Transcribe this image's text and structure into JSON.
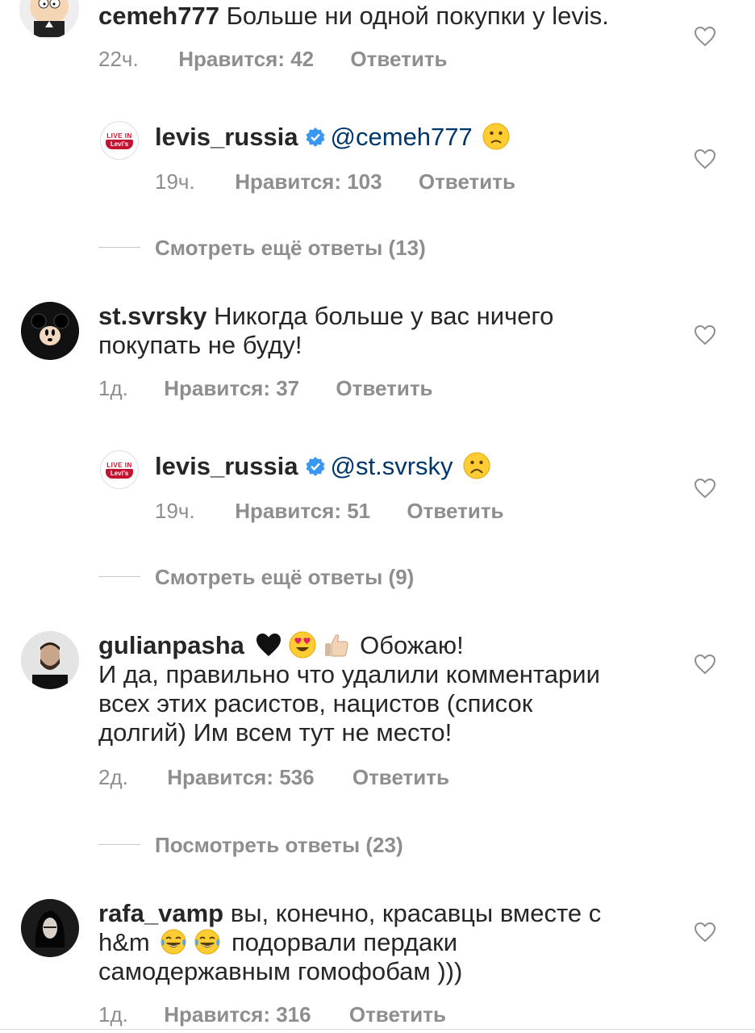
{
  "comments": [
    {
      "user": "cemeh777",
      "text": "Больше ни одной покупки у levis.",
      "time": "22ч.",
      "likes": "Нравится: 42",
      "reply": "Ответить",
      "avatar": "south-park-avatar-icon",
      "reply_item": {
        "user": "levis_russia",
        "mention": "@cemeh777",
        "emoji": "slightly-frowning-face-icon",
        "time": "19ч.",
        "likes": "Нравится: 103",
        "reply": "Ответить"
      },
      "more": "Смотреть ещё ответы (13)"
    },
    {
      "user": "st.svrsky",
      "text_line1": "Никогда больше у вас ничего",
      "text_line2": "покупать не буду!",
      "time": "1д.",
      "likes": "Нравится: 37",
      "reply": "Ответить",
      "avatar": "mickey-avatar-icon",
      "reply_item": {
        "user": "levis_russia",
        "mention": "@st.svrsky",
        "emoji": "frowning-face-icon",
        "time": "19ч.",
        "likes": "Нравится: 51",
        "reply": "Ответить"
      },
      "more": "Смотреть ещё ответы (9)"
    },
    {
      "user": "gulianpasha",
      "text_line1_end": "Обожаю!",
      "text_line2": "И да, правильно что удалили комментарии",
      "text_line3": "всех этих расистов, нацистов (список",
      "text_line4": "долгий) Им всем тут не место!",
      "time": "2д.",
      "likes": "Нравится: 536",
      "reply": "Ответить",
      "avatar": "man-avatar-icon",
      "more": "Посмотреть ответы (23)"
    },
    {
      "user": "rafa_vamp",
      "text_line1": "вы, конечно, красавцы вместе с",
      "text_line2_start": "h&m",
      "text_line2_end": "подорвали пердаки",
      "text_line3": "самодержавным гомофобам )))",
      "time": "1д.",
      "likes": "Нравится: 316",
      "reply": "Ответить",
      "avatar": "woman-avatar-icon"
    }
  ],
  "brand_logo": {
    "top": "LIVE IN",
    "bottom": "Levi's"
  },
  "colors": {
    "text": "#262626",
    "secondary": "#8e8e8e",
    "mention": "#00376b",
    "verified": "#3897f0",
    "levis_red": "#c41230"
  }
}
